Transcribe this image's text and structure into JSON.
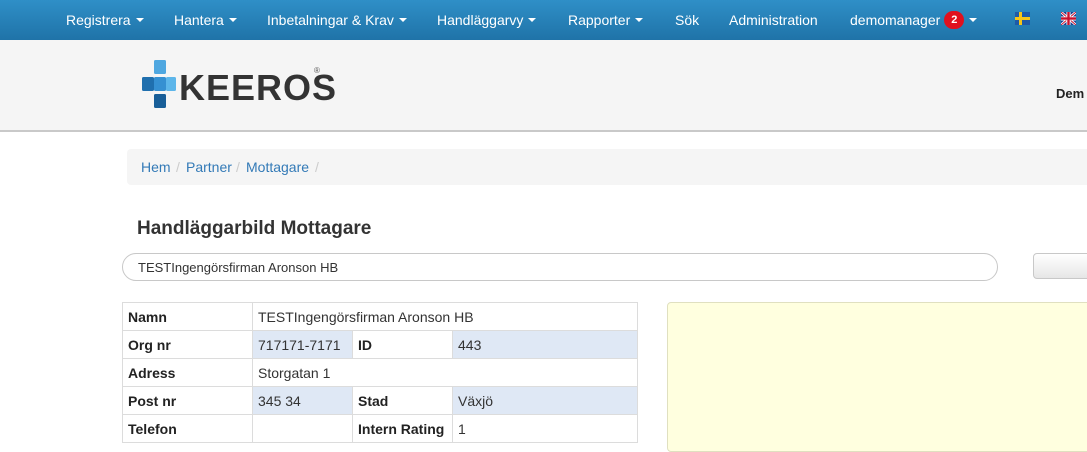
{
  "nav": {
    "registrera": "Registrera",
    "hantera": "Hantera",
    "inbetalningar": "Inbetalningar & Krav",
    "handlaggarvy": "Handläggarvy",
    "rapporter": "Rapporter",
    "sok": "Sök",
    "administration": "Administration",
    "user": "demomanager",
    "notification_count": "2"
  },
  "header": {
    "logo_text": "KEEROS",
    "logo_reg": "®",
    "user_short": "Dem"
  },
  "breadcrumb": {
    "home": "Hem",
    "partner": "Partner",
    "current": "Mottagare",
    "separator": "/"
  },
  "page": {
    "title": "Handläggarbild Mottagare"
  },
  "search": {
    "value": "TESTIngengörsfirman Aronson HB"
  },
  "info": {
    "namn_label": "Namn",
    "namn_value": "TESTIngengörsfirman Aronson HB",
    "orgnr_label": "Org nr",
    "orgnr_value": "717171-7171",
    "id_label": "ID",
    "id_value": "443",
    "adress_label": "Adress",
    "adress_value": "Storgatan 1",
    "postnr_label": "Post nr",
    "postnr_value": "345 34",
    "stad_label": "Stad",
    "stad_value": "Växjö",
    "telefon_label": "Telefon",
    "telefon_value": "",
    "rating_label": "Intern Rating",
    "rating_value": "1"
  },
  "colors": {
    "nav_bg": "#2680bb",
    "link": "#337ab7",
    "badge": "#e0101e",
    "note_bg": "#ffffdf",
    "row_alt": "#dfe8f5"
  },
  "icons": {
    "swedish_flag": "flag-se-icon",
    "uk_flag": "flag-uk-icon",
    "logo_mark": "keeros-cross-logo"
  }
}
